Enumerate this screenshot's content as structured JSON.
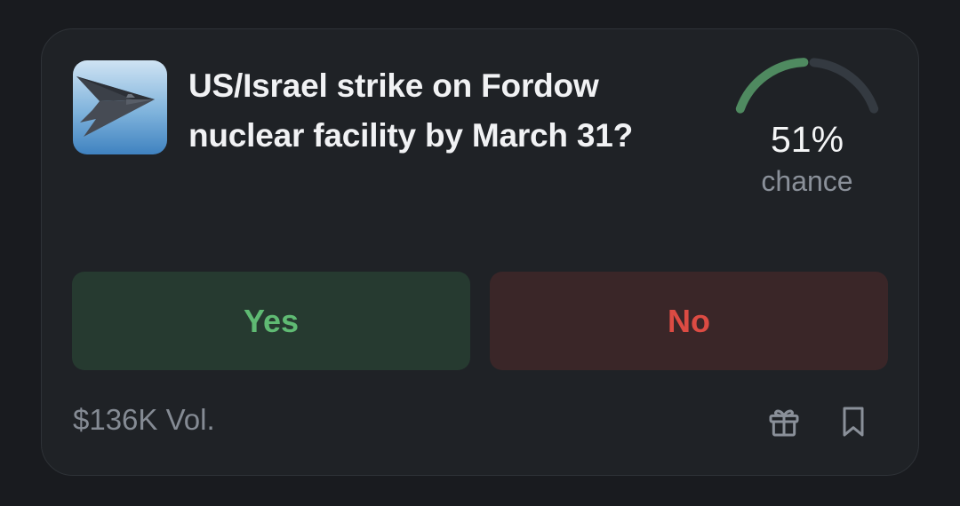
{
  "market": {
    "question": "US/Israel strike on Fordow nuclear facility by March 31?",
    "chance_value": "51%",
    "chance_fraction": 0.51,
    "chance_label": "chance",
    "image_icon": "stealth-bomber-image",
    "volume": "$136K Vol."
  },
  "buttons": {
    "yes_label": "Yes",
    "no_label": "No"
  },
  "icons": {
    "gift": "gift-icon",
    "bookmark": "bookmark-icon"
  },
  "colors": {
    "gauge_filled": "#4f8a60",
    "gauge_track": "#343a41",
    "yes_text": "#5fba73",
    "no_text": "#dc4b43"
  }
}
